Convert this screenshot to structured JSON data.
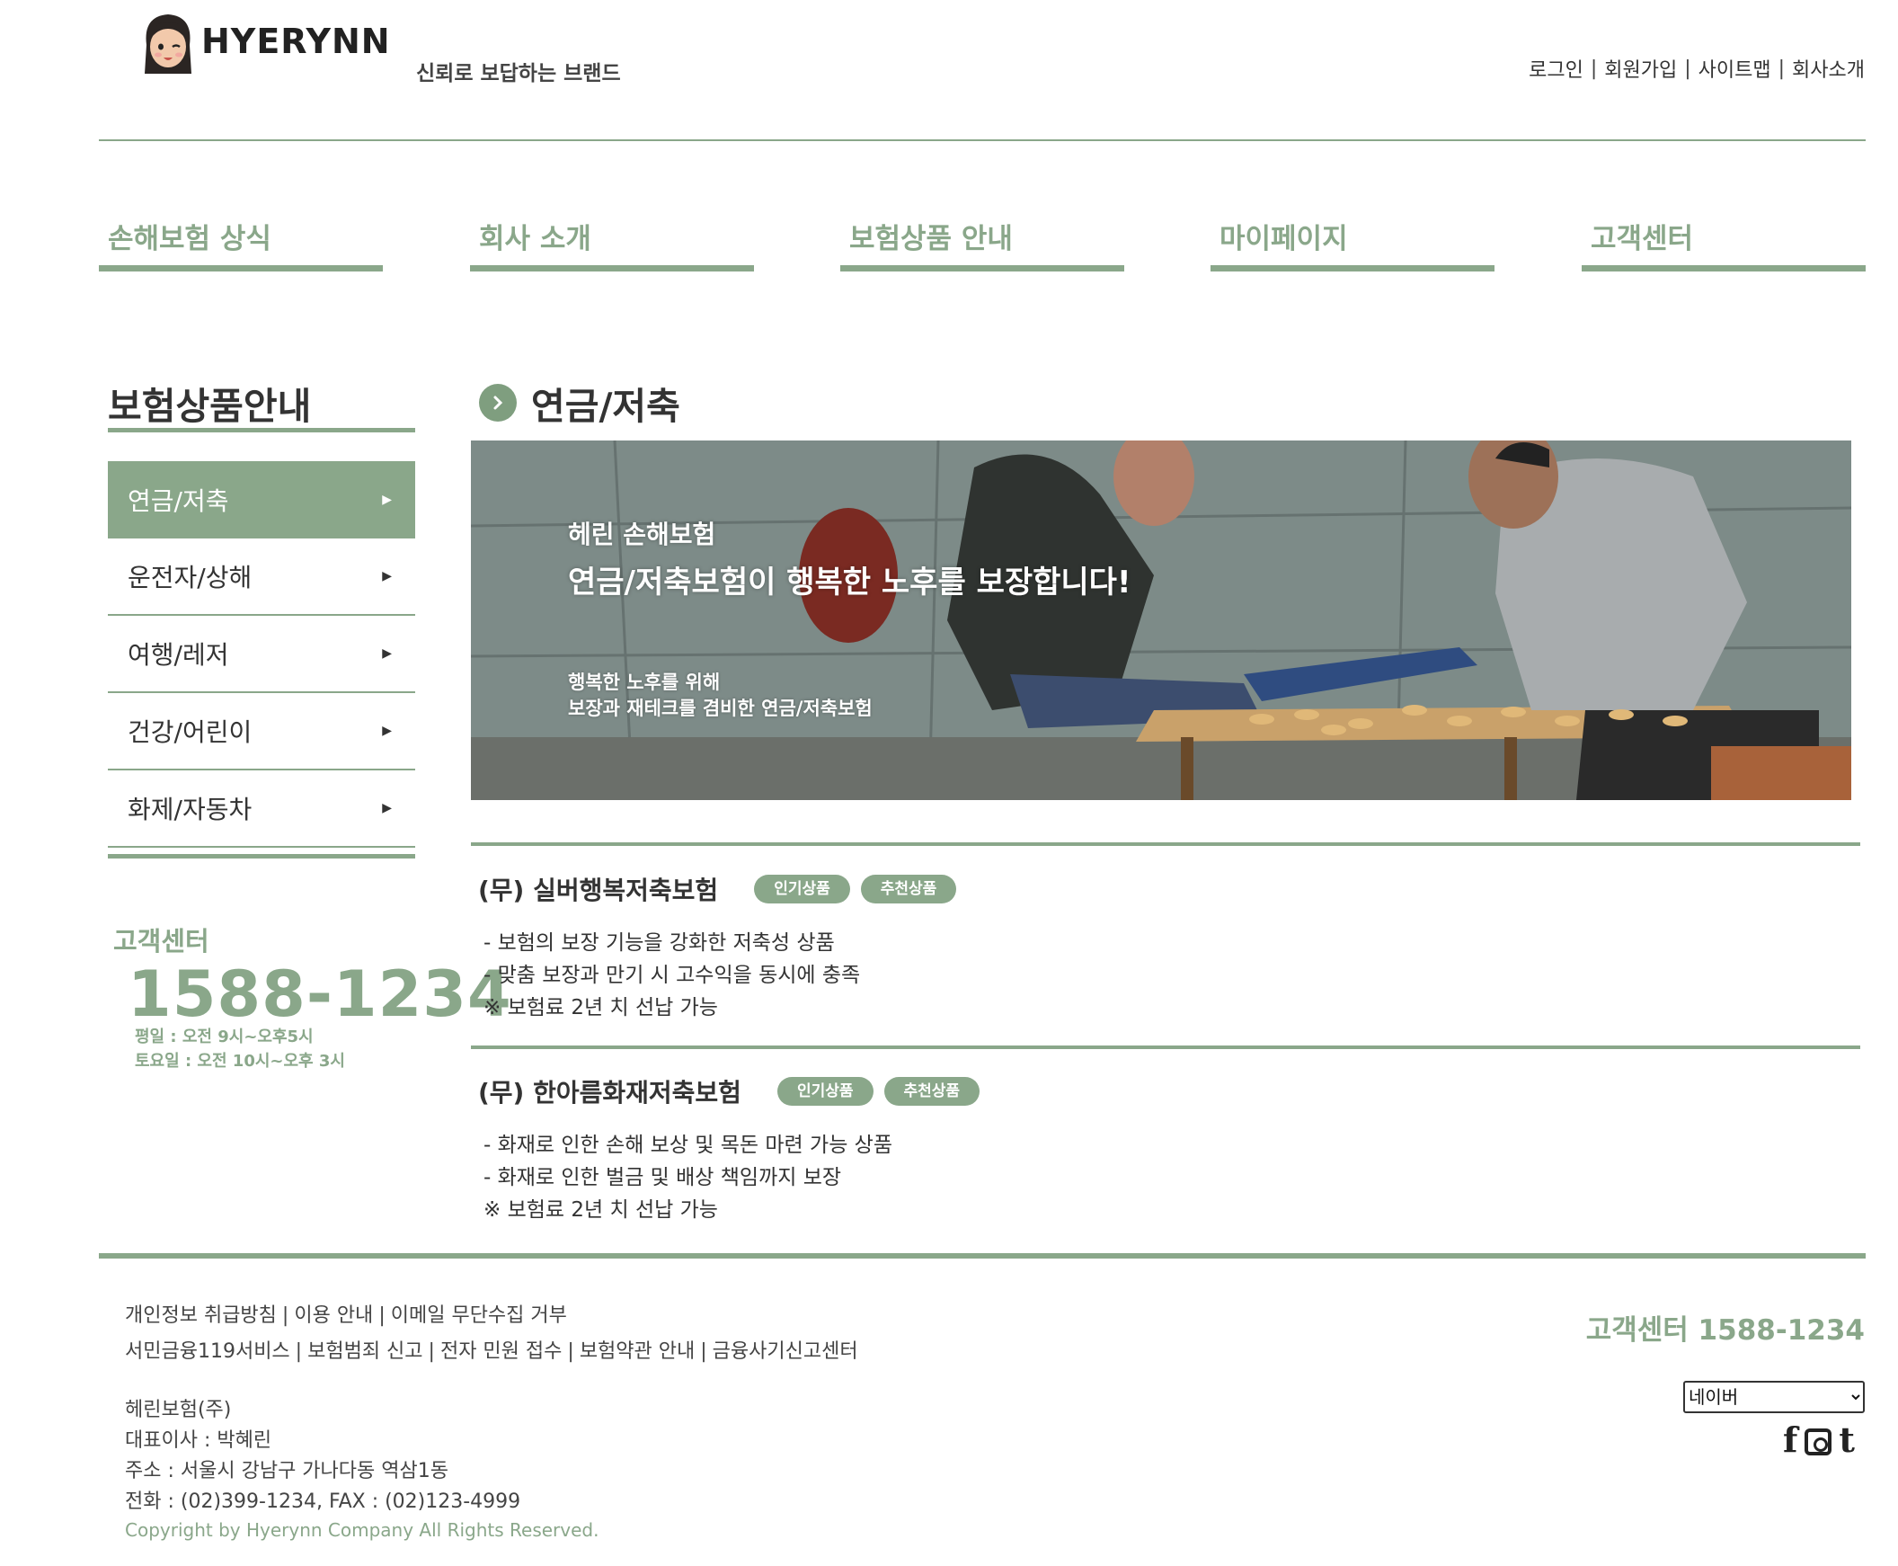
{
  "header": {
    "logo_text": "HYERYNN",
    "tagline": "신뢰로 보답하는 브랜드",
    "util_links": [
      "로그인",
      "회원가입",
      "사이트맵",
      "회사소개"
    ]
  },
  "nav": {
    "items": [
      "손해보험 상식",
      "회사 소개",
      "보험상품 안내",
      "마이페이지",
      "고객센터"
    ]
  },
  "sidebar": {
    "title": "보험상품안내",
    "items": [
      {
        "label": "연금/저축",
        "active": true
      },
      {
        "label": "운전자/상해",
        "active": false
      },
      {
        "label": "여행/레저",
        "active": false
      },
      {
        "label": "건강/어린이",
        "active": false
      },
      {
        "label": "화제/자동차",
        "active": false
      }
    ],
    "cs": {
      "label": "고객센터",
      "phone": "1588-1234",
      "hours": [
        "평일 : 오전 9시~오후5시",
        "토요일 : 오전 10시~오후 3시"
      ]
    }
  },
  "content": {
    "title": "연금/저축",
    "banner": {
      "line1": "헤린 손해보험",
      "line2": "연금/저축보험이 행복한 노후를 보장합니다!",
      "line3": "행복한 노후를 위해",
      "line4": "보장과 재테크를 겸비한 연금/저축보험"
    },
    "products": [
      {
        "name": "(무) 실버행복저축보험",
        "badges": [
          "인기상품",
          "추천상품"
        ],
        "desc": [
          "- 보험의 보장 기능을 강화한 저축성 상품",
          "- 맞춤 보장과 만기 시 고수익을 동시에 충족",
          "※ 보험료 2년 치 선납 가능"
        ]
      },
      {
        "name": "(무) 한아름화재저축보험",
        "badges": [
          "인기상품",
          "추천상품"
        ],
        "desc": [
          "- 화재로 인한 손해 보상 및 목돈 마련 가능 상품",
          "- 화재로 인한 벌금 및 배상 책임까지 보장",
          "※ 보험료 2년 치 선납 가능"
        ]
      }
    ]
  },
  "footer": {
    "links_row1": [
      "개인정보 취급방침",
      "이용 안내",
      "이메일 무단수집 거부"
    ],
    "links_row2": [
      "서민금융119서비스",
      "보험범죄 신고",
      "전자 민원 접수",
      "보험약관 안내",
      "금융사기신고센터"
    ],
    "company": [
      "헤린보험(주)",
      "대표이사 : 박혜린",
      "주소 : 서울시 강남구 가나다동 역삼1동",
      "전화 : (02)399-1234, FAX : (02)123-4999"
    ],
    "copyright": "Copyright by Hyerynn Company All Rights Reserved.",
    "cs_text": "고객센터 1588-1234",
    "site_select": "네이버",
    "social": [
      "facebook-icon",
      "instagram-icon",
      "tumblr-icon"
    ]
  },
  "colors": {
    "accent": "#8aa78a",
    "text": "#333333"
  }
}
